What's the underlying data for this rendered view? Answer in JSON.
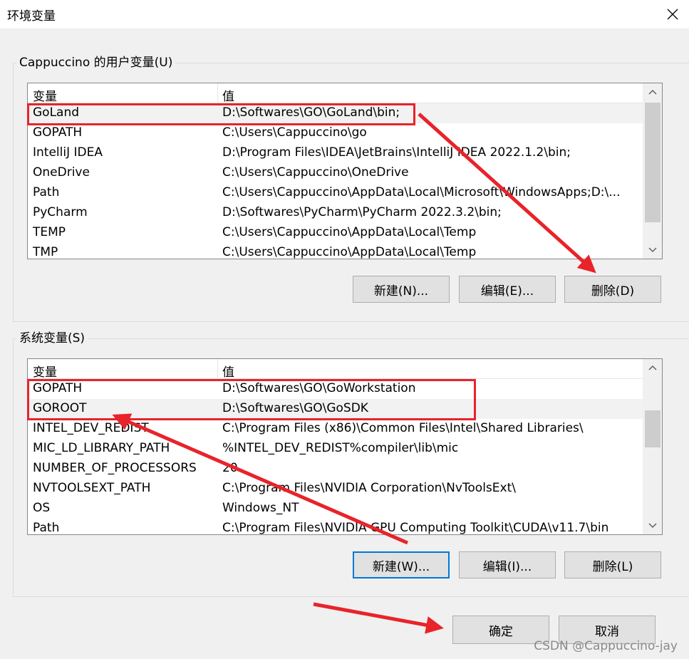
{
  "window": {
    "title": "环境变量",
    "close_icon": "close-icon"
  },
  "user_vars": {
    "group_label": "Cappuccino 的用户变量(U)",
    "col_name": "变量",
    "col_value": "值",
    "rows": [
      {
        "name": "GoLand",
        "value": "D:\\Softwares\\GO\\GoLand\\bin;"
      },
      {
        "name": "GOPATH",
        "value": "C:\\Users\\Cappuccino\\go"
      },
      {
        "name": "IntelliJ IDEA",
        "value": "D:\\Program Files\\IDEA\\JetBrains\\IntelliJ IDEA 2022.1.2\\bin;"
      },
      {
        "name": "OneDrive",
        "value": "C:\\Users\\Cappuccino\\OneDrive"
      },
      {
        "name": "Path",
        "value": "C:\\Users\\Cappuccino\\AppData\\Local\\Microsoft\\WindowsApps;D:\\..."
      },
      {
        "name": "PyCharm",
        "value": "D:\\Softwares\\PyCharm\\PyCharm 2022.3.2\\bin;"
      },
      {
        "name": "TEMP",
        "value": "C:\\Users\\Cappuccino\\AppData\\Local\\Temp"
      },
      {
        "name": "TMP",
        "value": "C:\\Users\\Cappuccino\\AppData\\Local\\Temp"
      }
    ],
    "buttons": {
      "new": "新建(N)...",
      "edit": "编辑(E)...",
      "delete": "删除(D)"
    }
  },
  "system_vars": {
    "group_label": "系统变量(S)",
    "col_name": "变量",
    "col_value": "值",
    "rows": [
      {
        "name": "GOPATH",
        "value": "D:\\Softwares\\GO\\GoWorkstation"
      },
      {
        "name": "GOROOT",
        "value": "D:\\Softwares\\GO\\GoSDK"
      },
      {
        "name": "INTEL_DEV_REDIST",
        "value": "C:\\Program Files (x86)\\Common Files\\Intel\\Shared Libraries\\"
      },
      {
        "name": "MIC_LD_LIBRARY_PATH",
        "value": "%INTEL_DEV_REDIST%compiler\\lib\\mic"
      },
      {
        "name": "NUMBER_OF_PROCESSORS",
        "value": "20"
      },
      {
        "name": "NVTOOLSEXT_PATH",
        "value": "C:\\Program Files\\NVIDIA Corporation\\NvToolsExt\\"
      },
      {
        "name": "OS",
        "value": "Windows_NT"
      },
      {
        "name": "Path",
        "value": "C:\\Program Files\\NVIDIA GPU Computing Toolkit\\CUDA\\v11.7\\bin"
      }
    ],
    "buttons": {
      "new": "新建(W)...",
      "edit": "编辑(I)...",
      "delete": "删除(L)"
    }
  },
  "footer": {
    "ok": "确定",
    "cancel": "取消"
  },
  "watermark": "CSDN @Cappuccino-jay",
  "colors": {
    "annotation_red": "#e8232a",
    "focus_blue": "#0078d7"
  }
}
